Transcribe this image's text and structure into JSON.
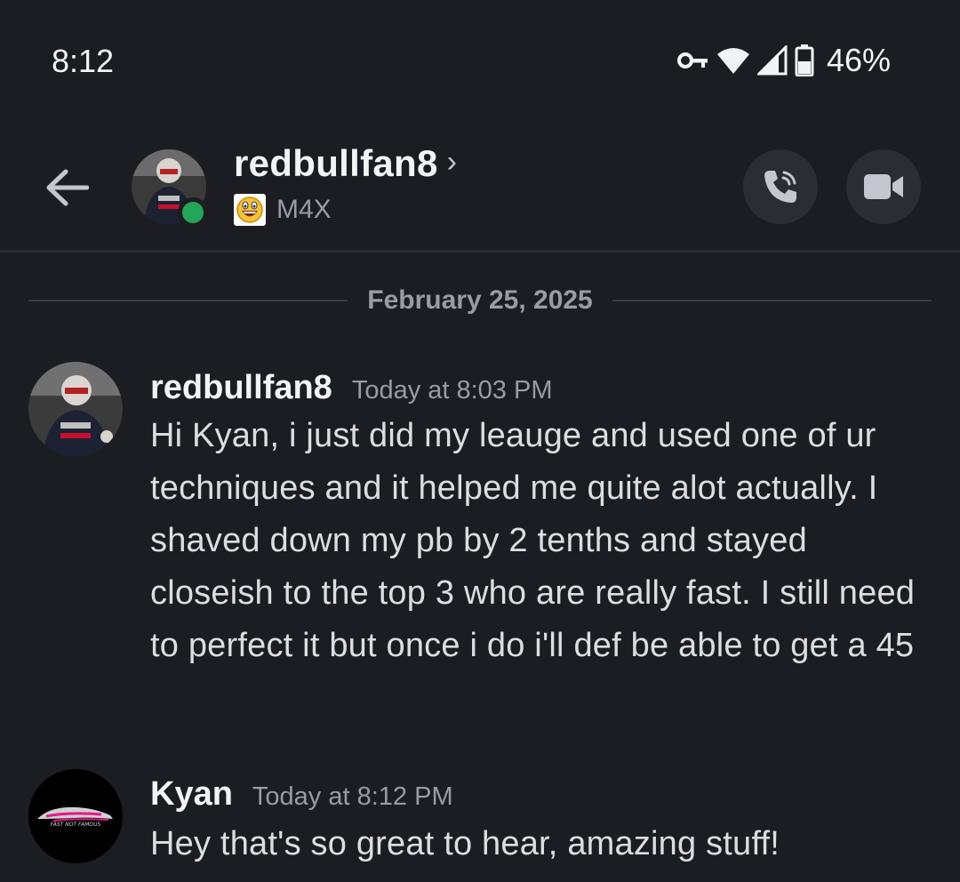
{
  "status_bar": {
    "time": "8:12",
    "battery_percent": "46%",
    "icons": [
      "vpn-key-icon",
      "wifi-icon",
      "signal-icon",
      "battery-icon"
    ]
  },
  "header": {
    "username": "redbullfan8",
    "chevron": "›",
    "custom_status": "M4X",
    "online_status_color": "#23a55a",
    "buttons": [
      "voice-call-icon",
      "video-call-icon"
    ]
  },
  "divider": {
    "date": "February 25, 2025"
  },
  "messages": [
    {
      "author": "redbullfan8",
      "timestamp": "Today at 8:03 PM",
      "text": "Hi Kyan, i just did my leauge and used one of ur techniques and it helped me quite alot actually. I shaved down my pb by 2 tenths and stayed closeish to the top 3 who are really fast. I still need to perfect it but once i do i'll def be able to get a 45"
    },
    {
      "author": "Kyan",
      "timestamp": "Today at 8:12 PM",
      "text": "Hey that's so great to hear, amazing stuff!"
    }
  ],
  "avatar_logo_text": "FAST NOT FAMOUS",
  "colors": {
    "background": "#1c1d22",
    "button_bg": "#2b2d33",
    "muted_text": "#9a9ca4",
    "accent_pink": "#e8168b"
  }
}
